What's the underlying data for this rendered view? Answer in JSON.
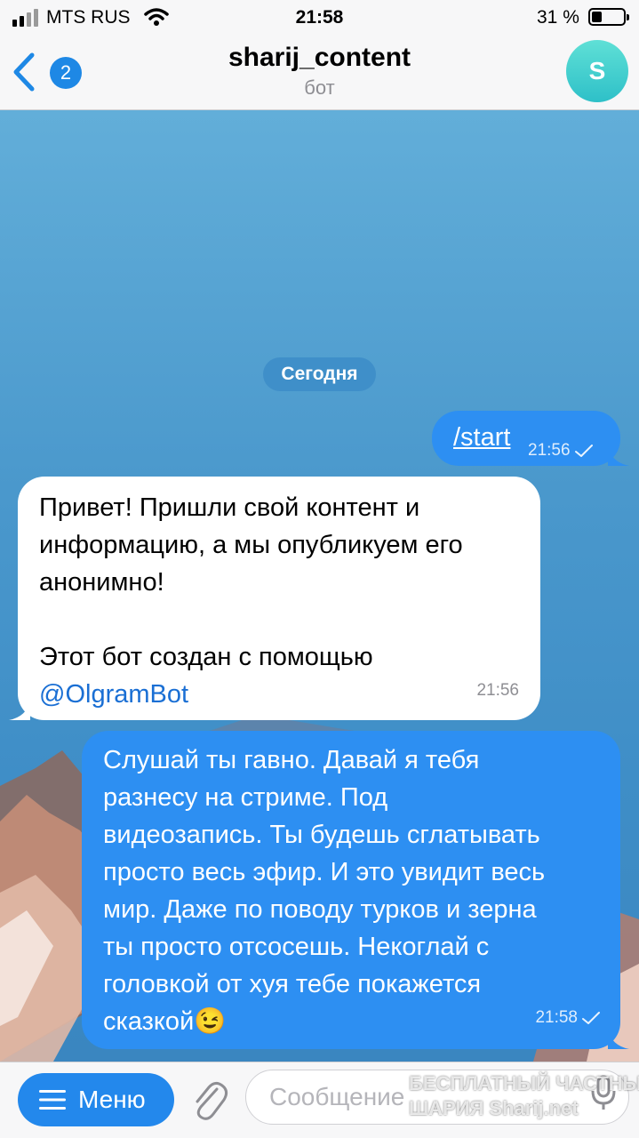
{
  "status_bar": {
    "carrier": "MTS RUS",
    "time": "21:58",
    "battery_percent": "31 %",
    "battery_level": 0.31
  },
  "header": {
    "back_badge": "2",
    "title": "sharij_content",
    "subtitle": "бот",
    "avatar_letter": "S"
  },
  "chat": {
    "date_separator": "Сегодня",
    "messages": [
      {
        "direction": "outgoing",
        "text": "/start",
        "time": "21:56"
      },
      {
        "direction": "incoming",
        "lines": [
          "Привет! Пришли свой контент и",
          "информацию, а мы опубликуем его",
          "анонимно!",
          "",
          "Этот бот создан с помощью"
        ],
        "link": "@OlgramBot",
        "time": "21:56"
      },
      {
        "direction": "outgoing",
        "lines": [
          "Слушай ты гавно. Давай я тебя",
          "разнесу на стриме. Под",
          "видеозапись. Ты будешь сглатывать",
          "просто весь эфир. И это увидит весь",
          "мир. Даже по поводу турков и зерна",
          "ты просто отсосешь. Некоглай с",
          "головкой от хуя тебе покажется",
          "сказкой😉"
        ],
        "time": "21:58"
      }
    ]
  },
  "bottom_bar": {
    "menu_label": "Меню",
    "input_placeholder": "Сообщение",
    "watermark_line1": "БЕСПЛАТНЫЙ ЧАСТНЫЙ",
    "watermark_line2": "ШАРИЯ Sharij.net"
  },
  "colors": {
    "accent": "#2388ec",
    "outgoing_bubble": "#2d8ff2",
    "incoming_bubble": "#ffffff",
    "link": "#1a6fd4"
  }
}
